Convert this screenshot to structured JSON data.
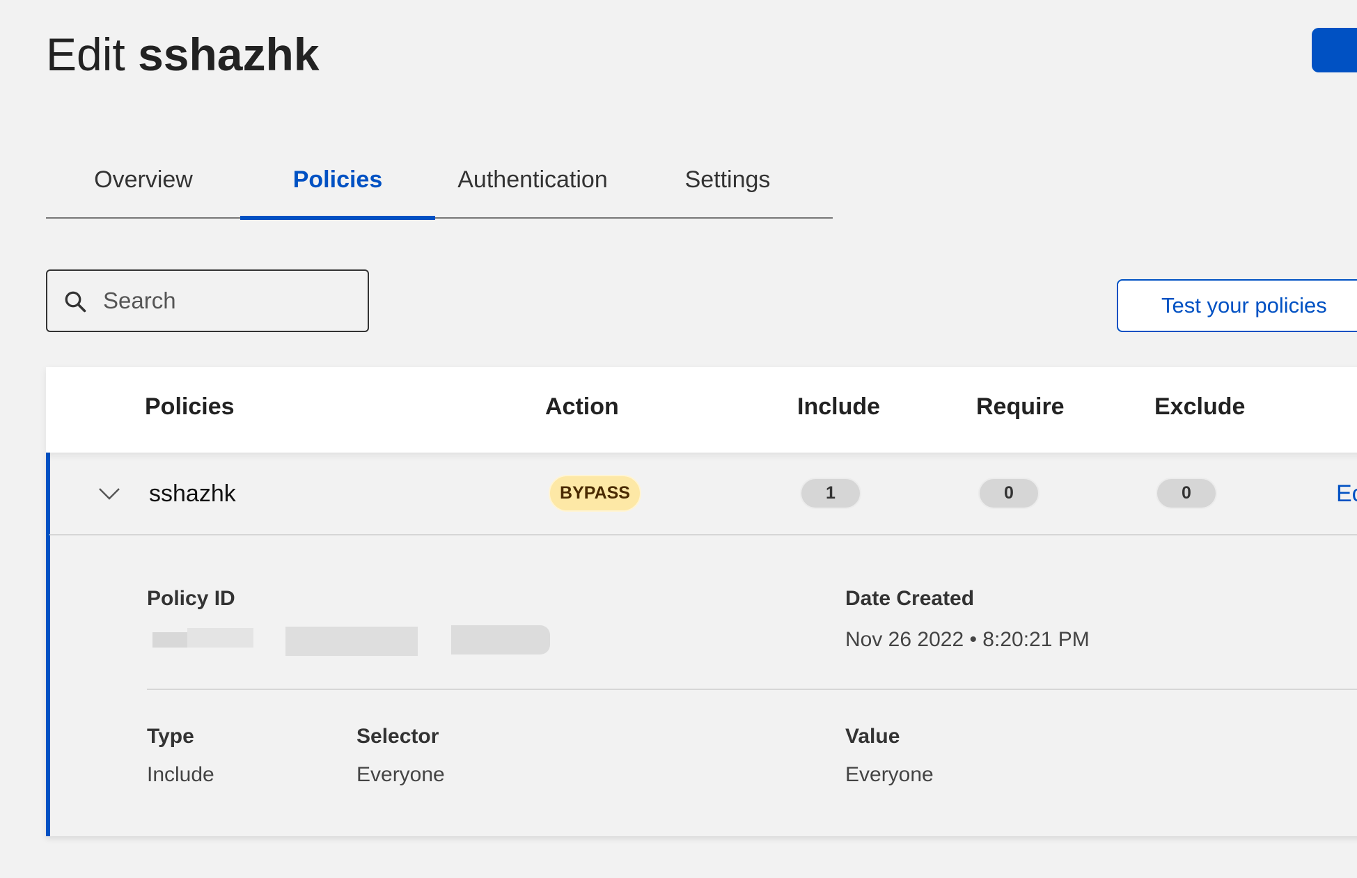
{
  "header": {
    "title_prefix": "Edit",
    "title_name": "sshazhk"
  },
  "tabs": [
    {
      "label": "Overview",
      "active": false
    },
    {
      "label": "Policies",
      "active": true
    },
    {
      "label": "Authentication",
      "active": false
    },
    {
      "label": "Settings",
      "active": false
    }
  ],
  "search": {
    "placeholder": "Search",
    "value": ""
  },
  "test_button": "Test your policies",
  "table": {
    "columns": [
      "Policies",
      "Action",
      "Include",
      "Require",
      "Exclude"
    ],
    "rows": [
      {
        "name": "sshazhk",
        "action": "BYPASS",
        "include": "1",
        "require": "0",
        "exclude": "0",
        "edit": "Ec"
      }
    ]
  },
  "details": {
    "policy_id_label": "Policy ID",
    "date_created_label": "Date Created",
    "date_created_value": "Nov 26 2022 • 8:20:21 PM",
    "rule": {
      "type_label": "Type",
      "type_value": "Include",
      "selector_label": "Selector",
      "selector_value": "Everyone",
      "value_label": "Value",
      "value_value": "Everyone"
    }
  },
  "colors": {
    "accent": "#0051c3",
    "bypass_badge": "#fde8a6",
    "background": "#f2f2f2"
  }
}
